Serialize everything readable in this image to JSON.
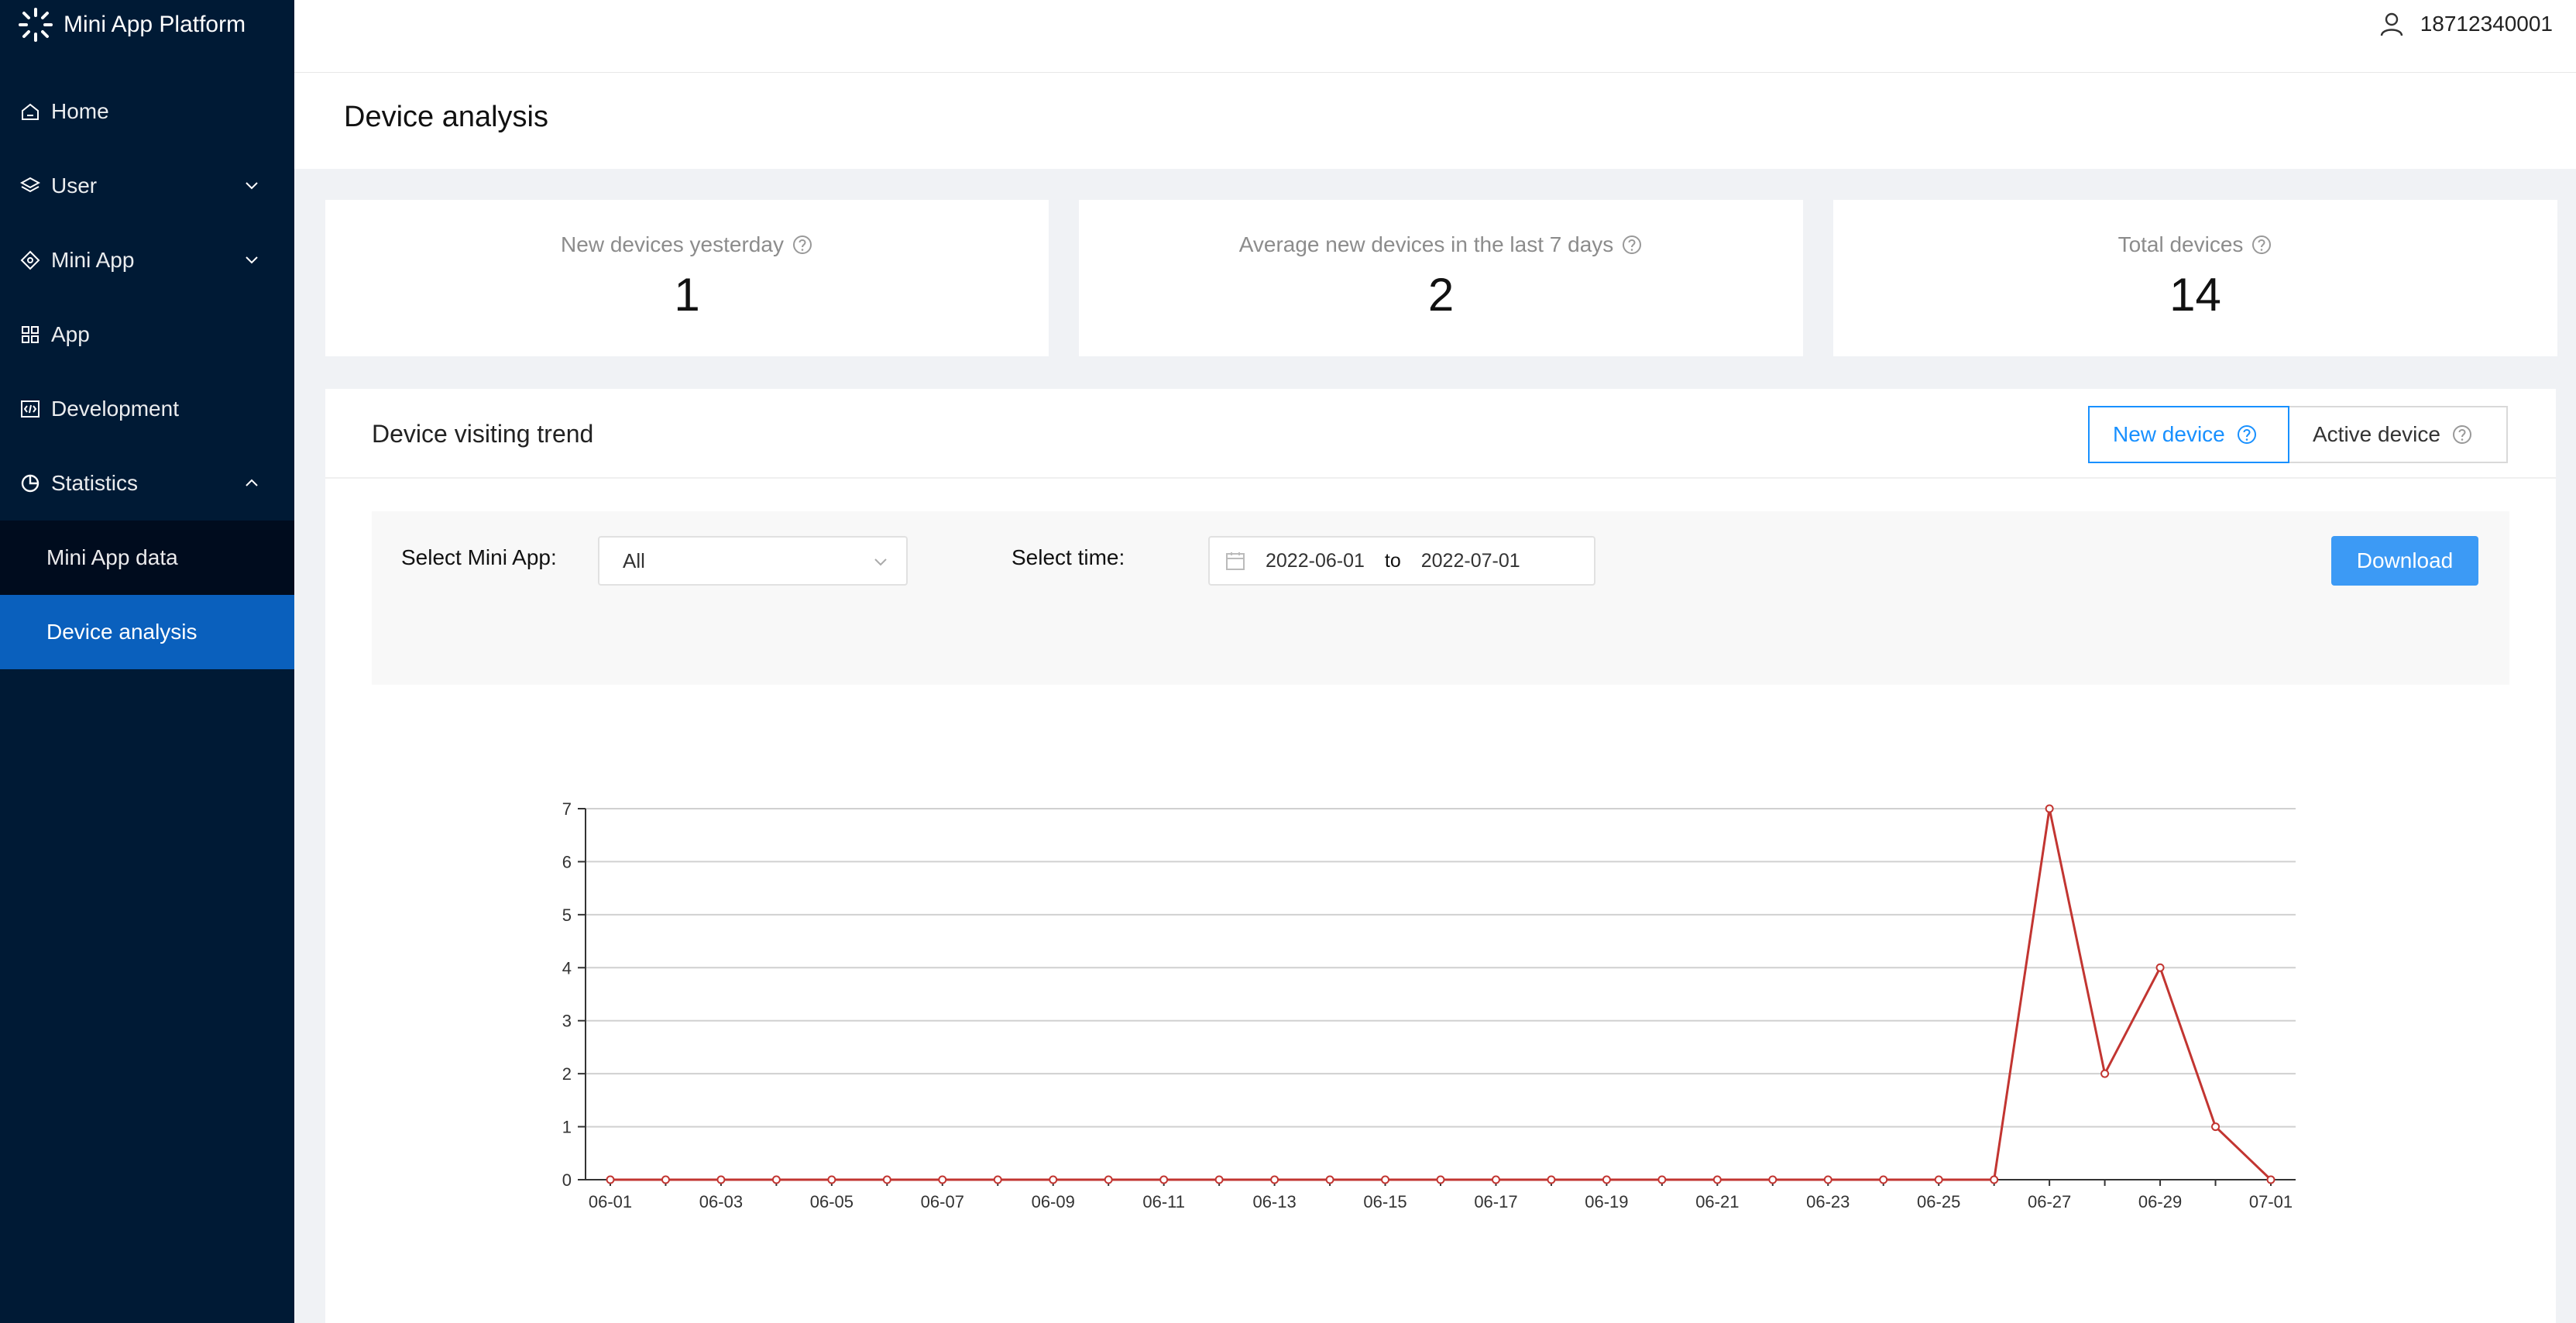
{
  "app": {
    "brand": "Mini App Platform"
  },
  "sidebar": {
    "items": [
      {
        "label": "Home",
        "icon": "home-icon"
      },
      {
        "label": "User",
        "icon": "layers-icon"
      },
      {
        "label": "Mini App",
        "icon": "diamond-icon"
      },
      {
        "label": "App",
        "icon": "grid-icon"
      },
      {
        "label": "Development",
        "icon": "code-icon"
      },
      {
        "label": "Statistics",
        "icon": "pie-chart-icon"
      }
    ],
    "sub_items": [
      {
        "label": "Mini App data"
      },
      {
        "label": "Device analysis",
        "active": true
      }
    ],
    "colors": {
      "background": "#001a35",
      "active": "#0a60bd"
    }
  },
  "header": {
    "user": "18712340001"
  },
  "page": {
    "title": "Device analysis"
  },
  "stats": [
    {
      "label": "New devices yesterday",
      "value": "1"
    },
    {
      "label": "Average new devices in the last 7 days",
      "value": "2"
    },
    {
      "label": "Total devices",
      "value": "14"
    }
  ],
  "trend": {
    "title": "Device visiting trend",
    "tabs": {
      "new": "New device",
      "active": "Active device"
    },
    "filter": {
      "app_label": "Select Mini App:",
      "app_value": "All",
      "time_label": "Select time:",
      "start": "2022-06-01",
      "sep": "to",
      "end": "2022-07-01",
      "download": "Download"
    }
  },
  "chart_data": {
    "type": "line",
    "x": [
      "06-01",
      "06-02",
      "06-03",
      "06-04",
      "06-05",
      "06-06",
      "06-07",
      "06-08",
      "06-09",
      "06-10",
      "06-11",
      "06-12",
      "06-13",
      "06-14",
      "06-15",
      "06-16",
      "06-17",
      "06-18",
      "06-19",
      "06-20",
      "06-21",
      "06-22",
      "06-23",
      "06-24",
      "06-25",
      "06-26",
      "06-27",
      "06-28",
      "06-29",
      "06-30",
      "07-01"
    ],
    "tick_labels": [
      "06-01",
      "06-03",
      "06-05",
      "06-07",
      "06-09",
      "06-11",
      "06-13",
      "06-15",
      "06-17",
      "06-19",
      "06-21",
      "06-23",
      "06-25",
      "06-27",
      "06-29",
      "07-01"
    ],
    "series": [
      {
        "values": [
          0,
          0,
          0,
          0,
          0,
          0,
          0,
          0,
          0,
          0,
          0,
          0,
          0,
          0,
          0,
          0,
          0,
          0,
          0,
          0,
          0,
          0,
          0,
          0,
          0,
          0,
          7,
          2,
          4,
          1,
          0
        ],
        "color": "#c23531"
      }
    ],
    "ylim": [
      0,
      7
    ],
    "yticks": [
      0,
      1,
      2,
      3,
      4,
      5,
      6,
      7
    ],
    "grid": true,
    "title": "",
    "xlabel": "",
    "ylabel": ""
  }
}
